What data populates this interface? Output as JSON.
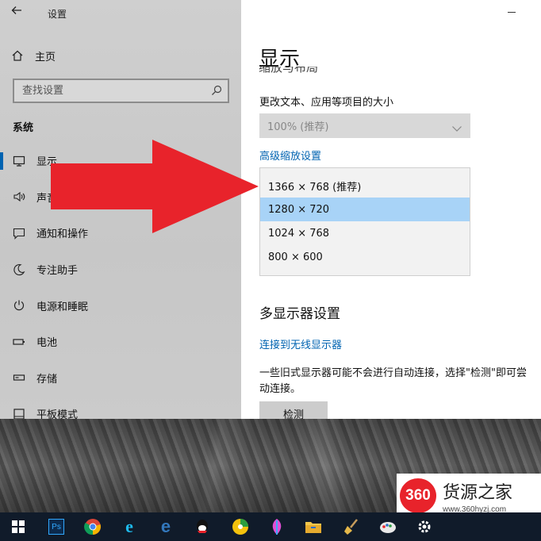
{
  "window": {
    "title": "设置"
  },
  "sidebar": {
    "home_label": "主页",
    "search_placeholder": "查找设置",
    "section_title": "系统",
    "items": [
      {
        "label": "显示",
        "icon": "monitor-icon",
        "active": true
      },
      {
        "label": "声音",
        "icon": "speaker-icon"
      },
      {
        "label": "通知和操作",
        "icon": "notification-icon"
      },
      {
        "label": "专注助手",
        "icon": "moon-icon"
      },
      {
        "label": "电源和睡眠",
        "icon": "power-icon"
      },
      {
        "label": "电池",
        "icon": "battery-icon"
      },
      {
        "label": "存储",
        "icon": "storage-icon"
      },
      {
        "label": "平板模式",
        "icon": "tablet-icon"
      }
    ]
  },
  "content": {
    "page_title": "显示",
    "cut_heading": "缩放与布局",
    "scale_label": "更改文本、应用等项目的大小",
    "scale_value": "100% (推荐)",
    "advanced_link": "高级缩放设置",
    "resolution_options": [
      {
        "label": "1366 × 768 (推荐)"
      },
      {
        "label": "1280 × 720",
        "selected": true
      },
      {
        "label": "1024 × 768"
      },
      {
        "label": "800 × 600"
      }
    ],
    "multi_display_title": "多显示器设置",
    "wireless_link": "连接到无线显示器",
    "description": "一些旧式显示器可能不会进行自动连接，选择\"检测\"即可尝\n动连接。",
    "detect_button": "检测"
  },
  "watermark": {
    "logo_text": "360",
    "name": "货源之家",
    "url": "www.360hyzj.com"
  },
  "taskbar": {
    "items": [
      "windows-start-icon",
      "photoshop-icon",
      "chrome-icon",
      "ie-icon",
      "edge-icon",
      "qq-icon",
      "app-green-icon",
      "feather-icon",
      "file-explorer-icon",
      "broom-icon",
      "paint-icon",
      "settings-gear-icon"
    ],
    "ps_label": "Ps"
  },
  "colors": {
    "accent": "#0063b1",
    "arrow": "#e8232b",
    "selected_row": "#a8d3f7",
    "taskbar": "#101b2a"
  }
}
